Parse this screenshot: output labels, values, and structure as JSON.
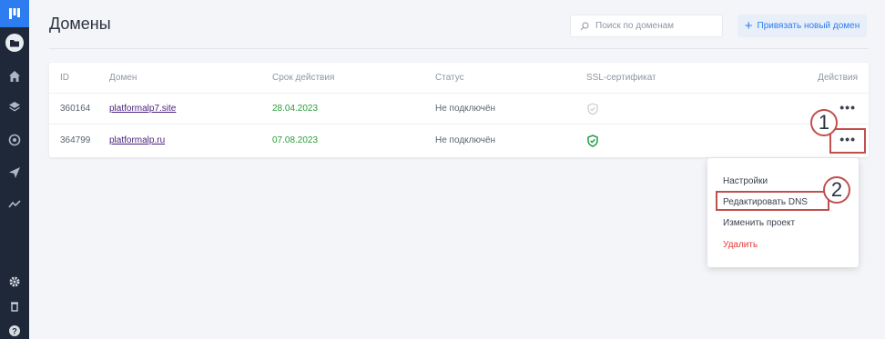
{
  "sidebar": {
    "items": [
      {
        "icon": "logo-icon"
      },
      {
        "icon": "folder-icon"
      },
      {
        "icon": "home-icon"
      },
      {
        "icon": "layers-icon"
      },
      {
        "icon": "integrations-icon"
      },
      {
        "icon": "send-icon"
      },
      {
        "icon": "analytics-icon"
      },
      {
        "icon": "gear-icon"
      },
      {
        "icon": "trash-icon"
      },
      {
        "icon": "help-icon"
      }
    ],
    "bg": "#1f2838",
    "accent": "#2d7df0"
  },
  "header": {
    "title": "Домены",
    "search_placeholder": "Поиск по доменам",
    "bind_button_label": "Привязать новый домен"
  },
  "table": {
    "columns": [
      "ID",
      "Домен",
      "Срок действия",
      "Статус",
      "SSL-сертификат",
      "Действия"
    ],
    "rows": [
      {
        "id": "360164",
        "domain": "platformalp7.site",
        "expires": "28.04.2023",
        "status": "Не подключён",
        "ssl": "inactive",
        "actions": "•••"
      },
      {
        "id": "364799",
        "domain": "platformalp.ru",
        "expires": "07.08.2023",
        "status": "Не подключён",
        "ssl": "active",
        "actions": "•••"
      }
    ]
  },
  "menu": {
    "items": [
      "Настройки",
      "Редактировать DNS",
      "Изменить проект",
      "Удалить"
    ]
  },
  "annotations": {
    "marker_1": "1",
    "marker_2": "2"
  },
  "colors": {
    "primary": "#2d7df0",
    "success": "#2a9d3a",
    "danger": "#e53935",
    "annotation": "#c0504d"
  }
}
